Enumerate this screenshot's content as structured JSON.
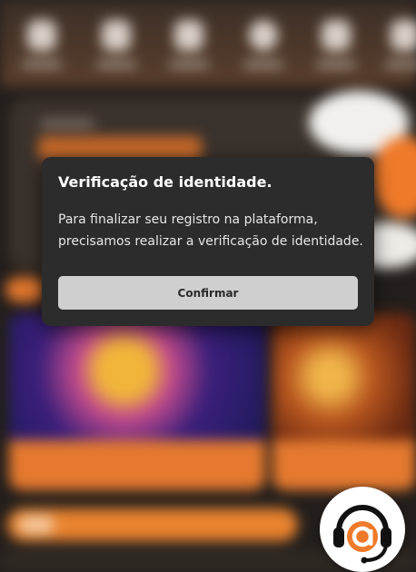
{
  "modal": {
    "title": "Verificação de identidade.",
    "message_line1": "Para finalizar seu registro na plataforma,",
    "message_line2": "precisamos realizar a verificação de identidade.",
    "confirm_label": "Confirmar"
  },
  "support": {
    "icon": "headset-support-icon"
  },
  "colors": {
    "accent": "#ef7a2a",
    "modal_background": "#2c2c2c",
    "button_background": "#cfcfcf"
  }
}
